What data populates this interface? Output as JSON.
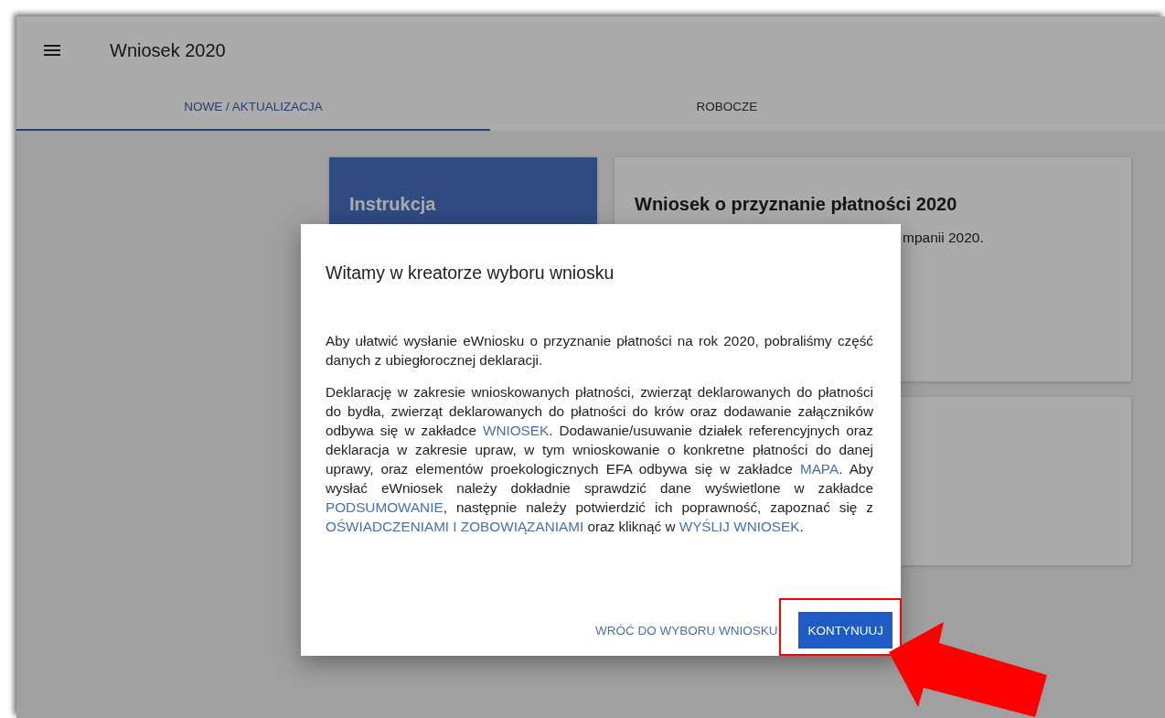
{
  "header": {
    "title": "Wniosek 2020"
  },
  "tabs": [
    {
      "label": "NOWE / AKTUALIZACJA",
      "selected": true
    },
    {
      "label": "ROBOCZE",
      "selected": false
    }
  ],
  "instruction_card": {
    "title": "Instrukcja"
  },
  "application_card": {
    "title": "Wniosek o przyznanie płatności 2020",
    "description": "mpanii 2020."
  },
  "dialog": {
    "title": "Witamy w kreatorze wyboru wniosku",
    "paragraphs": [
      [
        {
          "kind": "text",
          "text": "Aby ułatwić wysłanie eWniosku o przyznanie płatności na rok 2020, pobraliśmy część danych z ubiegłorocznej deklaracji."
        }
      ],
      [
        {
          "kind": "text",
          "text": "Deklarację w zakresie wnioskowanych płatności, zwierząt deklarowanych do płatności do bydła, zwierząt deklarowanych do płatności do krów oraz dodawanie załączników odbywa się w zakładce "
        },
        {
          "kind": "link",
          "text": "WNIOSEK"
        },
        {
          "kind": "text",
          "text": ". Dodawanie/usuwanie działek referencyjnych oraz deklaracja w zakresie upraw, w tym wnioskowanie o konkretne płatności do danej uprawy, oraz elementów proekologicznych EFA odbywa się w zakładce "
        },
        {
          "kind": "link",
          "text": "MAPA"
        },
        {
          "kind": "text",
          "text": ". Aby wysłać eWniosek należy dokładnie sprawdzić dane wyświetlone w zakładce "
        },
        {
          "kind": "link",
          "text": "PODSUMOWANIE"
        },
        {
          "kind": "text",
          "text": ", następnie należy potwierdzić ich poprawność, zapoznać się z "
        },
        {
          "kind": "link",
          "text": "OŚWIADCZENIAMI I ZOBOWIĄZANIAMI"
        },
        {
          "kind": "text",
          "text": " oraz kliknąć w "
        },
        {
          "kind": "link",
          "text": "WYŚLIJ WNIOSEK"
        },
        {
          "kind": "text",
          "text": "."
        }
      ]
    ],
    "buttons": [
      {
        "label": "WRÓĆ DO WYBORU WNIOSKU",
        "kind": "text"
      },
      {
        "label": "KONTYNUUJ",
        "kind": "filled"
      }
    ]
  }
}
